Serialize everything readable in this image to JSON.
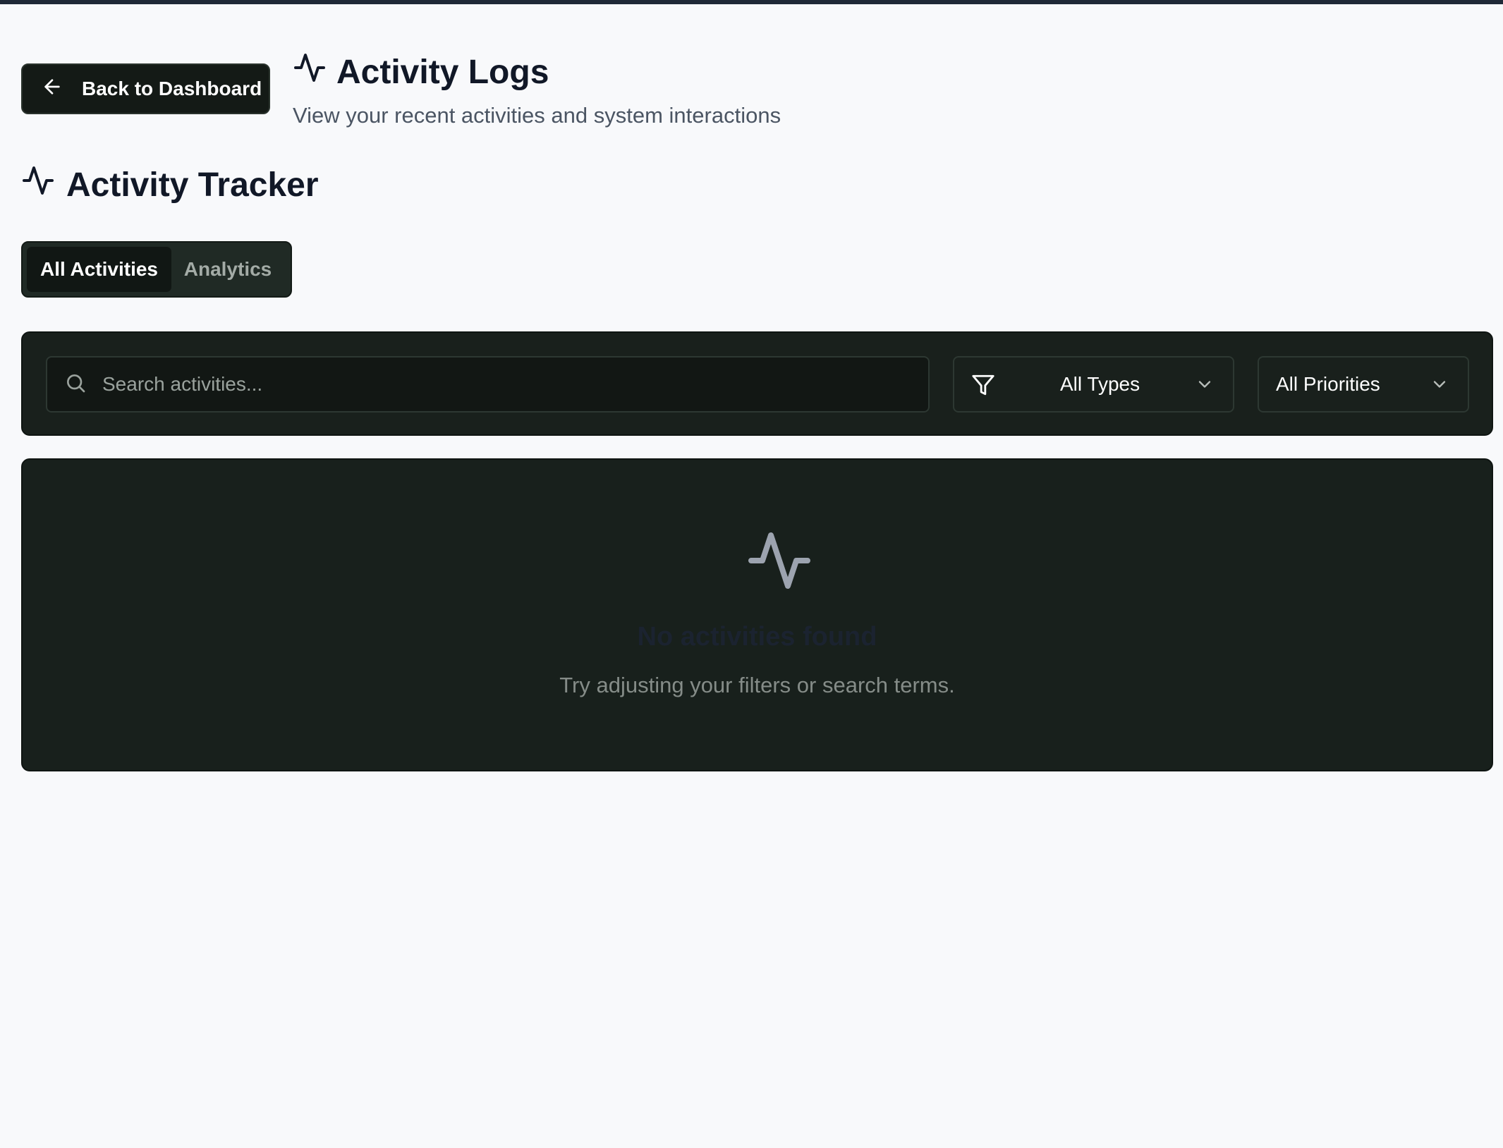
{
  "header": {
    "back_label": "Back to Dashboard",
    "title": "Activity Logs",
    "subtitle": "View your recent activities and system interactions"
  },
  "tracker": {
    "title": "Activity Tracker"
  },
  "tabs": [
    {
      "label": "All Activities",
      "active": true
    },
    {
      "label": "Analytics",
      "active": false
    }
  ],
  "filters": {
    "search_placeholder": "Search activities...",
    "search_value": "",
    "type_selected": "All Types",
    "priority_selected": "All Priorities"
  },
  "empty_state": {
    "title": "No activities found",
    "message": "Try adjusting your filters or search terms."
  },
  "icons": {
    "back": "arrow-left-icon",
    "activity": "activity-pulse-icon",
    "search": "search-icon",
    "filter": "filter-icon",
    "chevron": "chevron-down-icon"
  },
  "colors": {
    "background": "#f8f9fb",
    "panel": "#19201c",
    "text_primary": "#111827",
    "text_muted": "#4b5563"
  }
}
